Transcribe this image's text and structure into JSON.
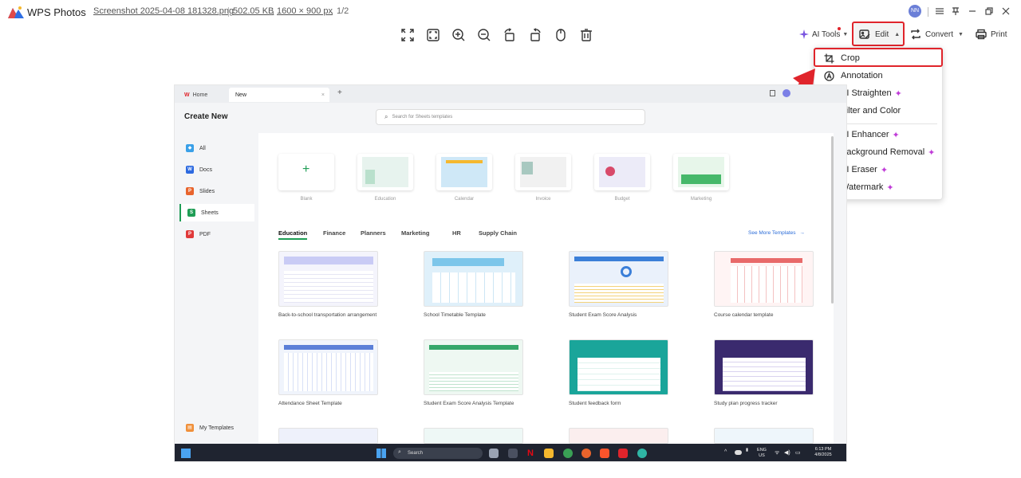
{
  "titlebar": {
    "app_name": "WPS Photos",
    "file_name": "Screenshot 2025-04-08 181328.png",
    "file_size": "502.05 KB",
    "dimensions": "1600 × 900 px",
    "index": "1/2",
    "avatar_initials": "NN"
  },
  "toolbar": {
    "ai_tools": "AI Tools",
    "edit": "Edit",
    "convert": "Convert",
    "print": "Print"
  },
  "edit_menu": {
    "items": [
      {
        "label": "Crop",
        "ai": false
      },
      {
        "label": "Annotation",
        "ai": false
      },
      {
        "label": "AI Straighten",
        "ai": true
      },
      {
        "label": "Filter and Color",
        "ai": false
      },
      {
        "label": "AI Enhancer",
        "ai": true
      },
      {
        "label": "Background Removal",
        "ai": true
      },
      {
        "label": "AI Eraser",
        "ai": true
      },
      {
        "label": "Watermark",
        "ai": true
      }
    ]
  },
  "shot": {
    "tabs": {
      "home": "Home",
      "new": "New"
    },
    "create_new": "Create New",
    "search_placeholder": "Search for Sheets templates",
    "sidebar": [
      {
        "label": "All",
        "color": "#3aa0e8"
      },
      {
        "label": "Docs",
        "color": "#2d6ae0"
      },
      {
        "label": "Slides",
        "color": "#e8642c"
      },
      {
        "label": "Sheets",
        "color": "#1f9d55"
      },
      {
        "label": "PDF",
        "color": "#e03a3a"
      }
    ],
    "my_templates": "My Templates",
    "template_types": [
      "Blank",
      "Education",
      "Calendar",
      "Invoice",
      "Budget",
      "Marketing"
    ],
    "categories": [
      "Education",
      "Finance",
      "Planners",
      "Marketing",
      "HR",
      "Supply Chain"
    ],
    "see_more": "See More Templates",
    "templates": [
      {
        "caption": "Back-to-school transportation arrangement",
        "color": "#7b7fe6"
      },
      {
        "caption": "School Timetable Template",
        "color": "#4fb5e0"
      },
      {
        "caption": "Student Exam Score Analysis",
        "color": "#3b7fd8"
      },
      {
        "caption": "Course calendar template",
        "color": "#e86a6a"
      },
      {
        "caption": "Attendance Sheet Template",
        "color": "#5b7fd8"
      },
      {
        "caption": "Student Exam Score Analysis Template",
        "color": "#35a86a"
      },
      {
        "caption": "Student feedback form",
        "color": "#1aa59a"
      },
      {
        "caption": "Study plan progress tracker",
        "color": "#3a2a6e"
      }
    ],
    "taskbar": {
      "search": "Search",
      "lang": "ENG",
      "region": "US",
      "time": "6:13 PM",
      "date": "4/8/2025"
    }
  },
  "colors": {
    "highlight": "#e0242b",
    "ai_sparkle": "#c03cd8",
    "accent": "#2b6cd8"
  }
}
